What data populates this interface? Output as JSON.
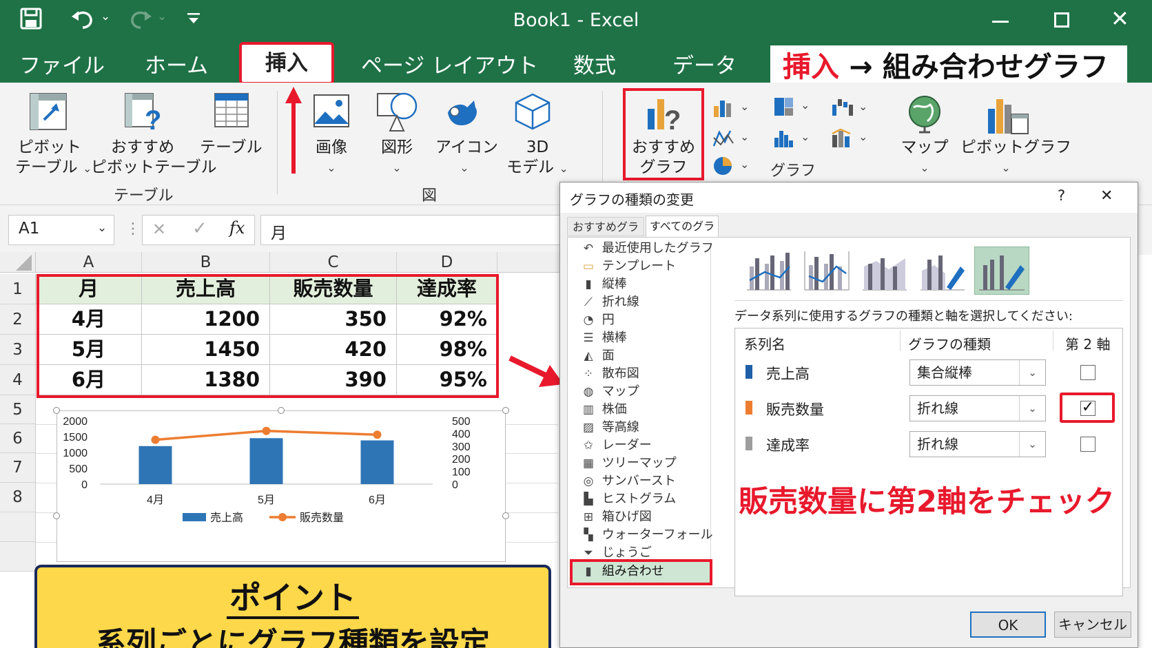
{
  "titlebar": {
    "title": "Book1  -  Excel"
  },
  "menu": {
    "file": "ファイル",
    "home": "ホーム",
    "insert": "挿入",
    "page_layout": "ページ レイアウト",
    "formulas": "数式",
    "data": "データ"
  },
  "callout_top": {
    "part1": "挿入",
    "arrow": "→",
    "part2": "組み合わせグラフ"
  },
  "ribbon": {
    "pivot_table_1": "ピボット",
    "pivot_table_2": "テーブル",
    "rec_pivot_1": "おすすめ",
    "rec_pivot_2": "ピボットテーブル",
    "table": "テーブル",
    "group_table": "テーブル",
    "image": "画像",
    "shapes": "図形",
    "icons": "アイコン",
    "model_1": "3D",
    "model_2": "モデル",
    "group_fig": "図",
    "rec_chart_1": "おすすめ",
    "rec_chart_2": "グラフ",
    "group_chart": "グラフ",
    "map": "マップ",
    "pivot_chart": "ピボットグラフ"
  },
  "formula_bar": {
    "name_box": "A1",
    "fx": "fx",
    "content": "月"
  },
  "sheet": {
    "columns": [
      "A",
      "B",
      "C",
      "D"
    ],
    "rows": [
      "1",
      "2",
      "3",
      "4",
      "5",
      "6",
      "7",
      "8"
    ],
    "headers": [
      "月",
      "売上高",
      "販売数量",
      "達成率"
    ],
    "data": [
      [
        "4月",
        "1200",
        "350",
        "92%"
      ],
      [
        "5月",
        "1450",
        "420",
        "98%"
      ],
      [
        "6月",
        "1380",
        "390",
        "95%"
      ]
    ]
  },
  "chart_data": {
    "type": "bar",
    "categories": [
      "4月",
      "5月",
      "6月"
    ],
    "series": [
      {
        "name": "売上高",
        "type": "bar",
        "axis": "primary",
        "values": [
          1200,
          1450,
          1380
        ],
        "color": "#2e75b6"
      },
      {
        "name": "販売数量",
        "type": "line",
        "axis": "secondary",
        "values": [
          350,
          420,
          390
        ],
        "color": "#ed7d31"
      }
    ],
    "y_ticks": [
      "2000",
      "1500",
      "1000",
      "500",
      "0"
    ],
    "y2_ticks": [
      "500",
      "400",
      "300",
      "200",
      "100",
      "0"
    ],
    "ylim": [
      0,
      2000
    ],
    "y2lim": [
      0,
      500
    ],
    "legend_position": "bottom"
  },
  "point_box": {
    "title": "ポイント",
    "text": "系列ごとにグラフ種類を設定"
  },
  "dialog": {
    "title": "グラフの種類の変更",
    "help": "?",
    "close": "✕",
    "tab_recommended": "おすすめグラフ",
    "tab_all": "すべてのグラフ",
    "chart_types": [
      {
        "icon": "↶",
        "label": "最近使用したグラフ"
      },
      {
        "icon": "▭",
        "label": "テンプレート"
      },
      {
        "icon": "▮",
        "label": "縦棒"
      },
      {
        "icon": "⟋",
        "label": "折れ線"
      },
      {
        "icon": "◔",
        "label": "円"
      },
      {
        "icon": "☰",
        "label": "横棒"
      },
      {
        "icon": "◭",
        "label": "面"
      },
      {
        "icon": "⁘",
        "label": "散布図"
      },
      {
        "icon": "◍",
        "label": "マップ"
      },
      {
        "icon": "▥",
        "label": "株価"
      },
      {
        "icon": "▨",
        "label": "等高線"
      },
      {
        "icon": "✩",
        "label": "レーダー"
      },
      {
        "icon": "▦",
        "label": "ツリーマップ"
      },
      {
        "icon": "◎",
        "label": "サンバースト"
      },
      {
        "icon": "▙",
        "label": "ヒストグラム"
      },
      {
        "icon": "⊞",
        "label": "箱ひげ図"
      },
      {
        "icon": "▚",
        "label": "ウォーターフォール"
      },
      {
        "icon": "⏷",
        "label": "じょうご"
      },
      {
        "icon": "▮",
        "label": "組み合わせ"
      }
    ],
    "instruction": "データ系列に使用するグラフの種類と軸を選択してください:",
    "col_series": "系列名",
    "col_type": "グラフの種類",
    "col_axis": "第 2 軸",
    "series_rows": [
      {
        "name": "売上高",
        "type": "集合縦棒",
        "color": "#1f5fa8",
        "secondary": false
      },
      {
        "name": "販売数量",
        "type": "折れ線",
        "color": "#ed7d31",
        "secondary": true
      },
      {
        "name": "達成率",
        "type": "折れ線",
        "color": "#9e9e9e",
        "secondary": false
      }
    ],
    "check_mark": "✓",
    "callout": "販売数量に第2軸をチェック",
    "ok": "OK",
    "cancel": "キャンセル"
  }
}
